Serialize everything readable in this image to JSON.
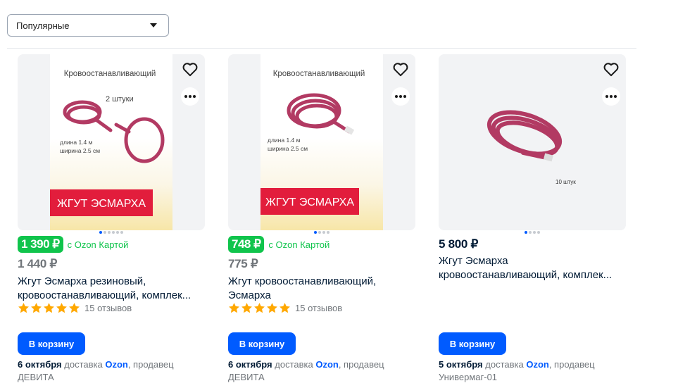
{
  "sort": {
    "selected": "Популярные"
  },
  "colors": {
    "accent": "#005bff",
    "green": "#10c44c",
    "product": "#b23a63"
  },
  "products": [
    {
      "image": {
        "caption": "Кровоостанавливающий",
        "count_text": "2 штуки",
        "spec1": "длина 1.4 м",
        "spec2": "ширина 2.5 см",
        "banner": "ЖГУТ ЭСМАРХА"
      },
      "ozon_price": "1 390 ₽",
      "ozon_card_label": "с Ozon Картой",
      "price": "1 440 ₽",
      "title": "Жгут Эсмарха резиновый, кровоостанавливающий, комплек...",
      "rating_stars": 5,
      "reviews": "15 отзывов",
      "cart_label": "В корзину",
      "delivery": {
        "date": "6 октября",
        "text1": " доставка ",
        "brand": "Ozon",
        "text2": ", продавец",
        "seller": "ДЕВИТА"
      }
    },
    {
      "image": {
        "caption": "Кровоостанавливающий",
        "spec1": "длина 1.4 м",
        "spec2": "ширина 2.5 см",
        "banner": "ЖГУТ ЭСМАРХА"
      },
      "ozon_price": "748 ₽",
      "ozon_card_label": "с Ozon Картой",
      "price": "775 ₽",
      "title": "Жгут кровоостанавливающий, Эсмарха",
      "rating_stars": 5,
      "reviews": "15 отзывов",
      "cart_label": "В корзину",
      "delivery": {
        "date": "6 октября",
        "text1": " доставка ",
        "brand": "Ozon",
        "text2": ", продавец",
        "seller": "ДЕВИТА"
      }
    },
    {
      "image": {
        "count_text": "10 штук"
      },
      "price": "5 800 ₽",
      "title": "Жгут Эсмарха кровоостанавливающий, комплек...",
      "cart_label": "В корзину",
      "delivery": {
        "date": "5 октября",
        "text1": " доставка ",
        "brand": "Ozon",
        "text2": ", продавец",
        "seller": "Универмаг-01"
      }
    }
  ]
}
